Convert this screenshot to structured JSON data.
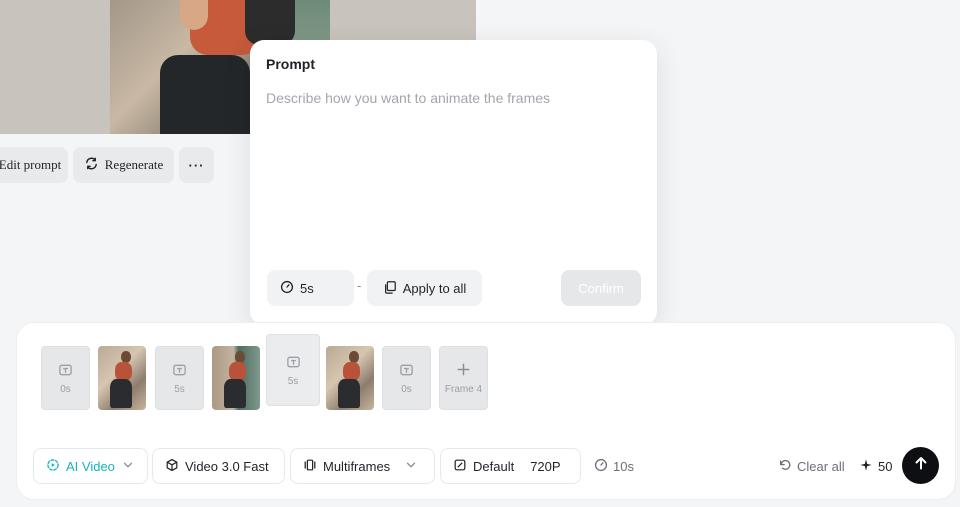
{
  "preview_actions": {
    "edit_prompt": "Edit prompt",
    "regenerate": "Regenerate",
    "more": "···"
  },
  "prompt_popover": {
    "title": "Prompt",
    "placeholder": "Describe how you want to animate the frames",
    "duration": "5s",
    "separator": "-",
    "apply_to_all": "Apply to all",
    "confirm": "Confirm"
  },
  "frames": [
    {
      "type": "duration",
      "label": "0s"
    },
    {
      "type": "image"
    },
    {
      "type": "duration",
      "label": "5s"
    },
    {
      "type": "image"
    },
    {
      "type": "duration",
      "label": "5s"
    },
    {
      "type": "image"
    },
    {
      "type": "duration",
      "label": "0s"
    },
    {
      "type": "add",
      "label": "Frame 4"
    }
  ],
  "toolbar": {
    "mode": "AI Video",
    "model": "Video 3.0 Fast",
    "frames_mode": "Multiframes",
    "ratio": "Default",
    "resolution": "720P",
    "total_duration": "10s",
    "clear_all": "Clear all",
    "credits": "50"
  },
  "colors": {
    "accent": "#14b3c1",
    "send_button": "#0e0f12"
  }
}
